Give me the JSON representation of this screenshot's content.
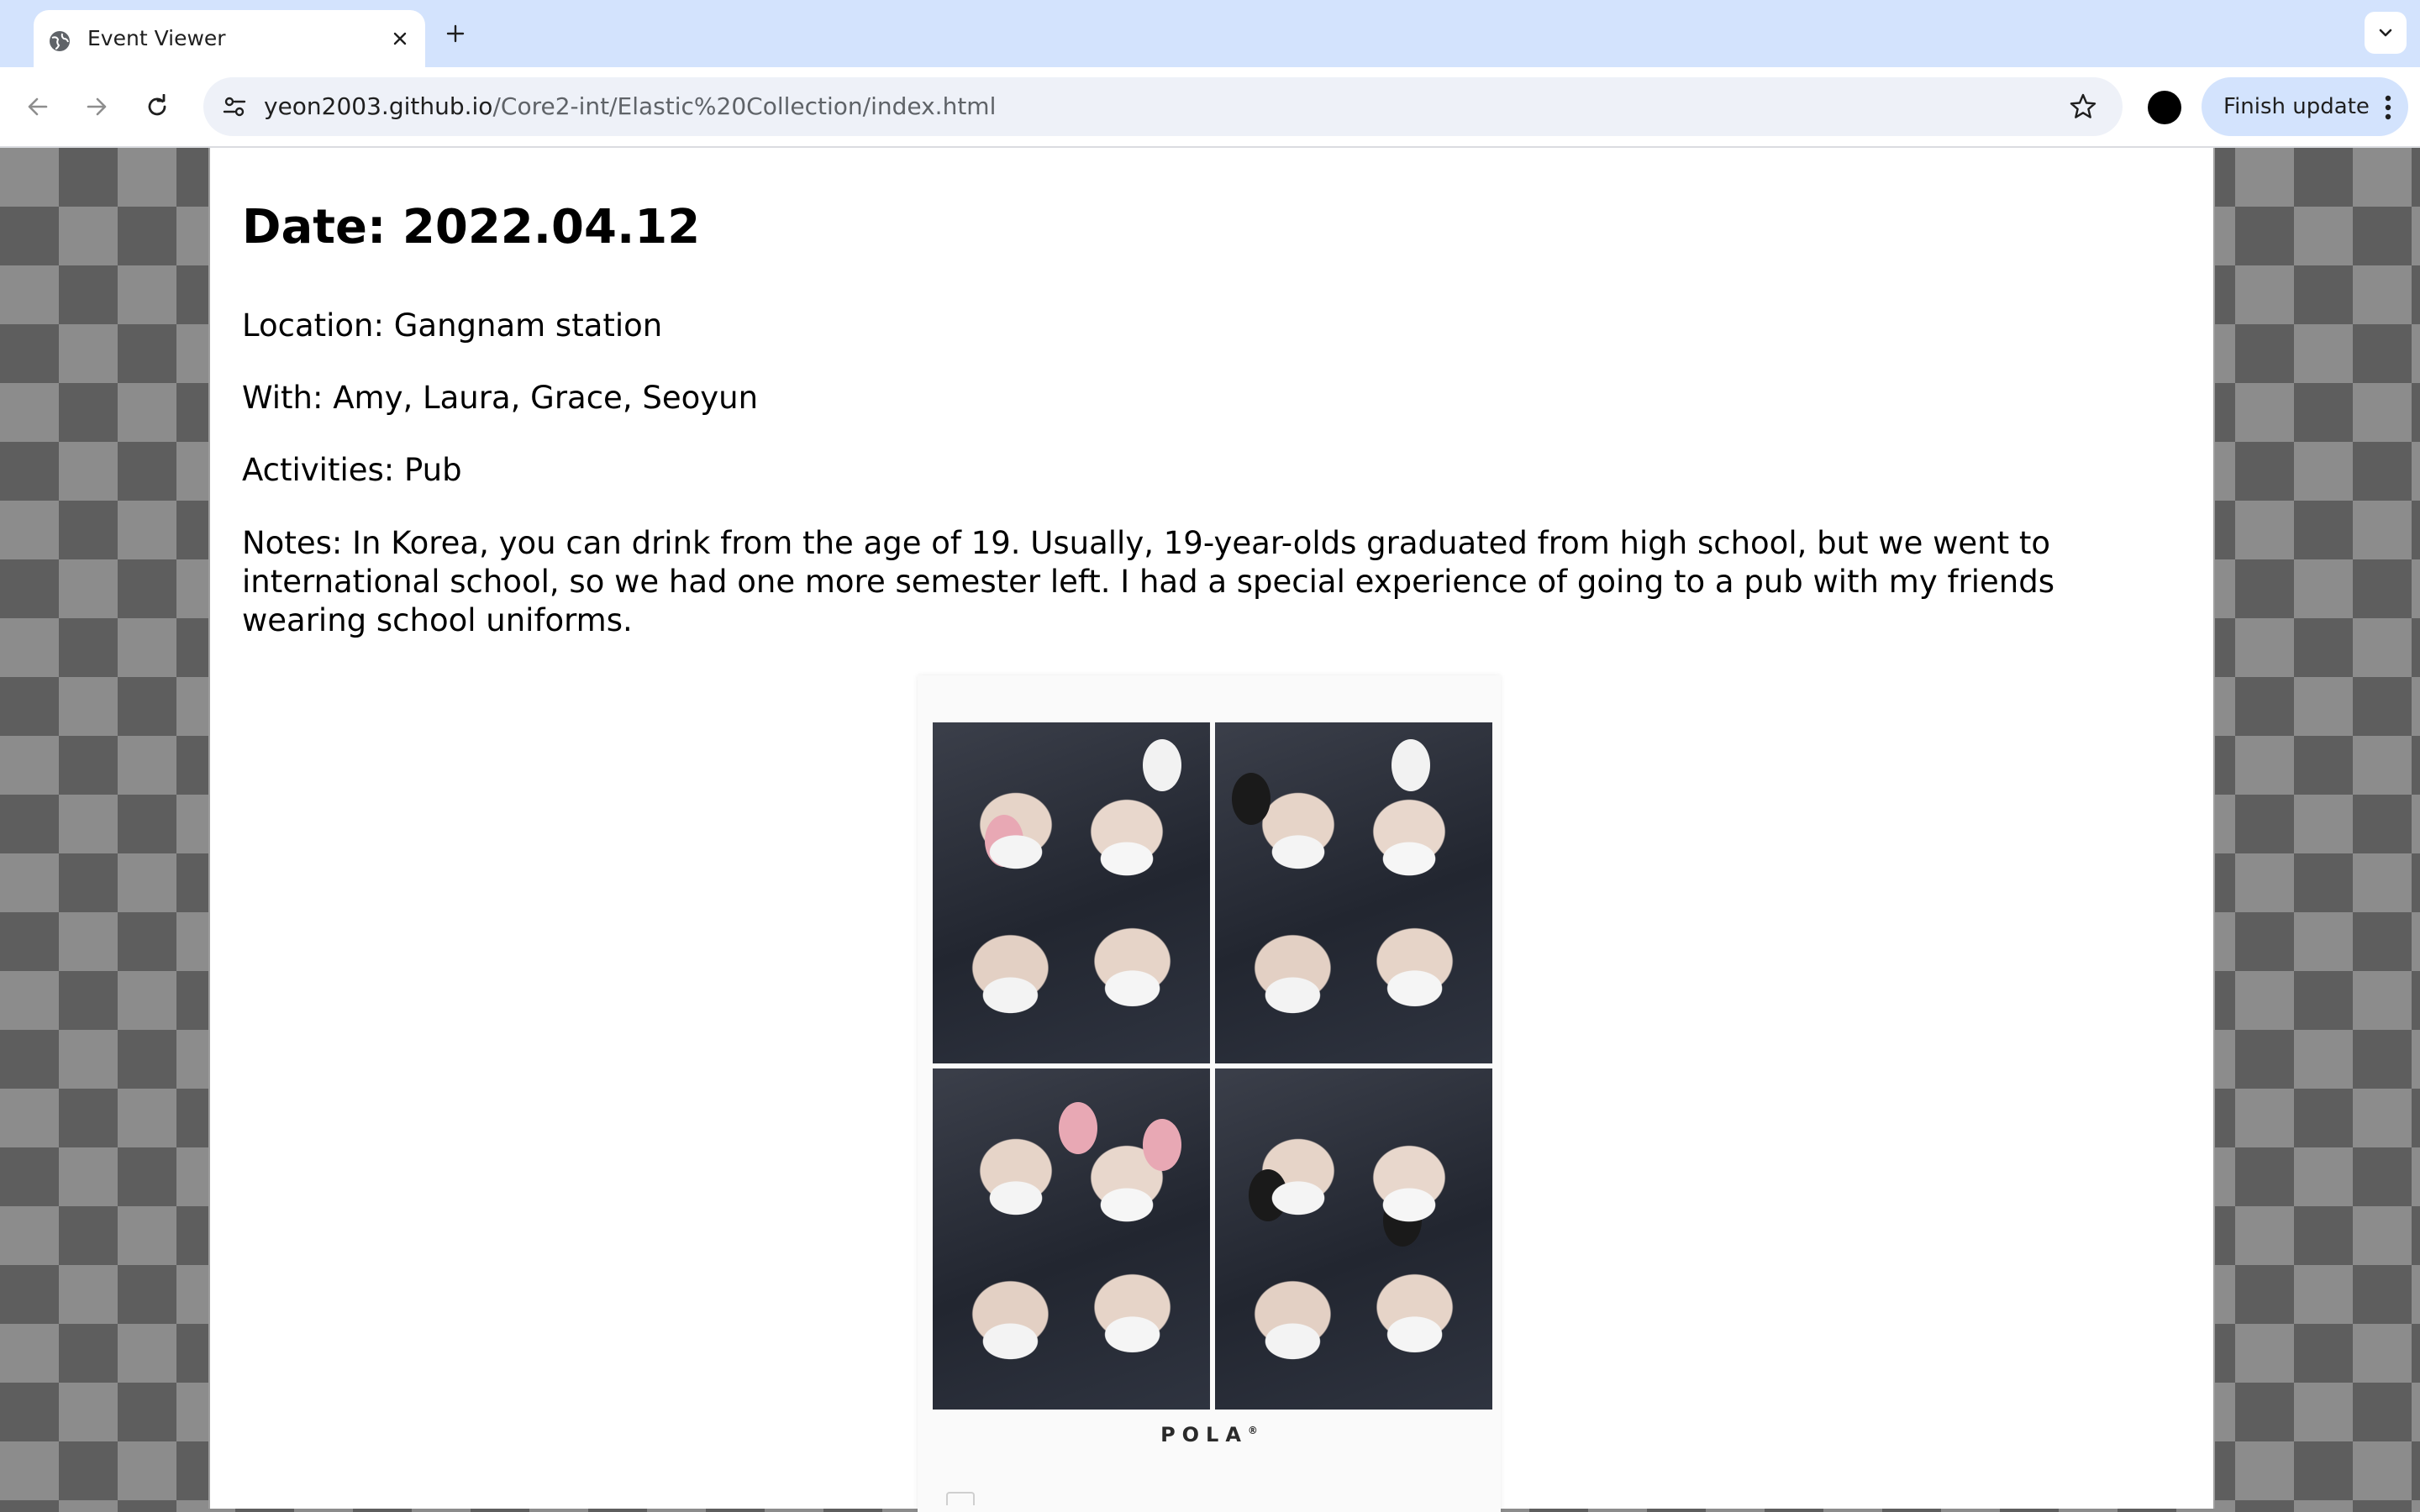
{
  "browser": {
    "tab": {
      "title": "Event Viewer",
      "favicon": "globe-icon"
    },
    "url": {
      "host": "yeon2003.github.io",
      "path": "/Core2-int/Elastic%20Collection/index.html"
    },
    "update_button_label": "Finish update"
  },
  "event": {
    "date_heading": "Date: 2022.04.12",
    "location": "Location: Gangnam station",
    "with": "With: Amy, Laura, Grace, Seoyun",
    "activities": "Activities: Pub",
    "notes": "Notes: In Korea, you can drink from the age of 19. Usually, 19-year-olds graduated from high school, but we went to international school, so we had one more semester left. I had a special experience of going to a pub with my friends wearing school uniforms.",
    "photo_strip": {
      "brand": "POLA",
      "brand_mark": "®",
      "frame_count": 4
    }
  },
  "colors": {
    "tabstrip": "#d3e3fd",
    "omnibox": "#eef1f8",
    "checker_dark": "#5e5e5e",
    "checker_light": "#8c8c8c"
  }
}
